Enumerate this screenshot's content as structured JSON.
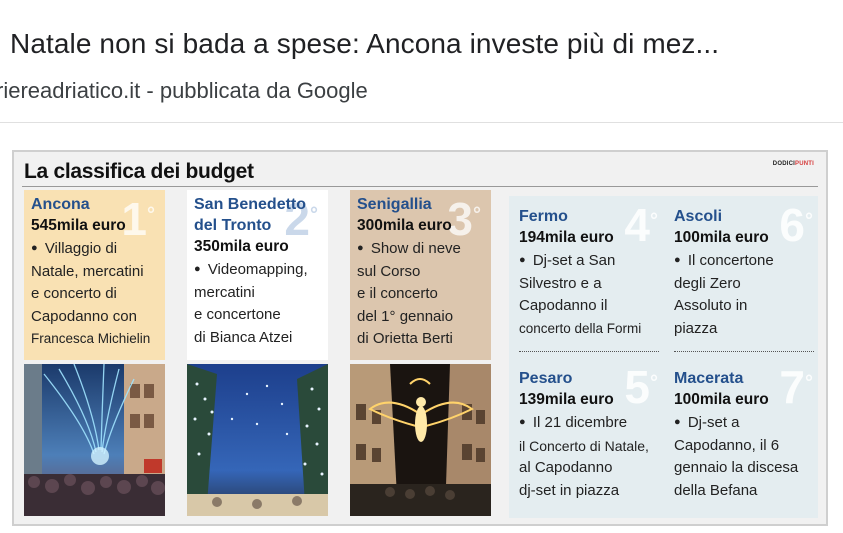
{
  "headline": "Natale non si bada a spese: Ancona investe più di mez...",
  "source": "riereadriatico.it - pubblicata da Google",
  "card": {
    "title": "La classifica dei budget",
    "brand_a": "DODICI",
    "brand_b": "PUNTI"
  },
  "bullet": "●",
  "columns": [
    {
      "name_lines": [
        "Ancona"
      ],
      "budget": "545mila euro",
      "rank": "1",
      "rank_sup": "°",
      "desc_lines": [
        "Villaggio di",
        "Natale, mercatini",
        "e concerto di",
        "Capodanno con",
        "Francesca Michielin"
      ]
    },
    {
      "name_lines": [
        "San Benedetto",
        "del Tronto"
      ],
      "budget": "350mila euro",
      "rank": "2",
      "rank_sup": "°",
      "desc_lines": [
        "Videomapping,",
        "mercatini",
        "e concertone",
        "di Bianca Atzei"
      ]
    },
    {
      "name_lines": [
        "Senigallia"
      ],
      "budget": "300mila euro",
      "rank": "3",
      "rank_sup": "°",
      "desc_lines": [
        "Show di neve",
        "sul Corso",
        "e il concerto",
        "del 1° gennaio",
        "di Orietta Berti"
      ]
    }
  ],
  "cells": [
    {
      "name": "Fermo",
      "budget": "194mila euro",
      "rank": "4",
      "rank_sup": "°",
      "desc_lines": [
        "Dj-set a San",
        "Silvestro e a",
        "Capodanno il",
        "concerto della Formi"
      ]
    },
    {
      "name": "Ascoli",
      "budget": "100mila euro",
      "rank": "6",
      "rank_sup": "°",
      "desc_lines": [
        "Il concertone",
        "degli Zero",
        "Assoluto in",
        "piazza"
      ]
    },
    {
      "name": "Pesaro",
      "budget": "139mila euro",
      "rank": "5",
      "rank_sup": "°",
      "desc_lines": [
        "Il 21 dicembre",
        "il Concerto di Natale,",
        "al Capodanno",
        "dj-set in piazza"
      ]
    },
    {
      "name": "Macerata",
      "budget": "100mila euro",
      "rank": "7",
      "rank_sup": "°",
      "desc_lines": [
        "Dj-set a",
        "Capodanno, il 6",
        "gennaio la discesa",
        "della Befana"
      ]
    }
  ],
  "colors": {
    "city_name": "#24508c",
    "ancona_bg": "#f9e1b3",
    "senigallia_bg": "#dcc6ae",
    "grid_bg": "#e4edf0"
  }
}
